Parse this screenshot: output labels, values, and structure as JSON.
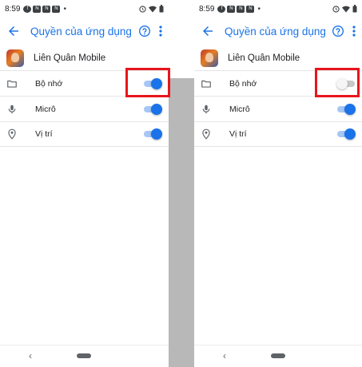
{
  "screens": [
    {
      "status": {
        "time": "8:59"
      },
      "appbar": {
        "title": "Quyền của ứng dụng"
      },
      "app": {
        "name": "Liên Quân Mobile"
      },
      "permissions": [
        {
          "label": "Bộ nhớ",
          "enabled": true,
          "icon": "folder-icon"
        },
        {
          "label": "Micrô",
          "enabled": true,
          "icon": "microphone-icon"
        },
        {
          "label": "Vị trí",
          "enabled": true,
          "icon": "location-pin-icon"
        }
      ]
    },
    {
      "status": {
        "time": "8:59"
      },
      "appbar": {
        "title": "Quyền của ứng dụng"
      },
      "app": {
        "name": "Liên Quân Mobile"
      },
      "permissions": [
        {
          "label": "Bộ nhớ",
          "enabled": false,
          "icon": "folder-icon"
        },
        {
          "label": "Micrô",
          "enabled": true,
          "icon": "microphone-icon"
        },
        {
          "label": "Vị trí",
          "enabled": true,
          "icon": "location-pin-icon"
        }
      ]
    }
  ],
  "colors": {
    "accent": "#1a73e8",
    "highlight": "#e8151c",
    "divider_strip": "#b7b8b7"
  }
}
